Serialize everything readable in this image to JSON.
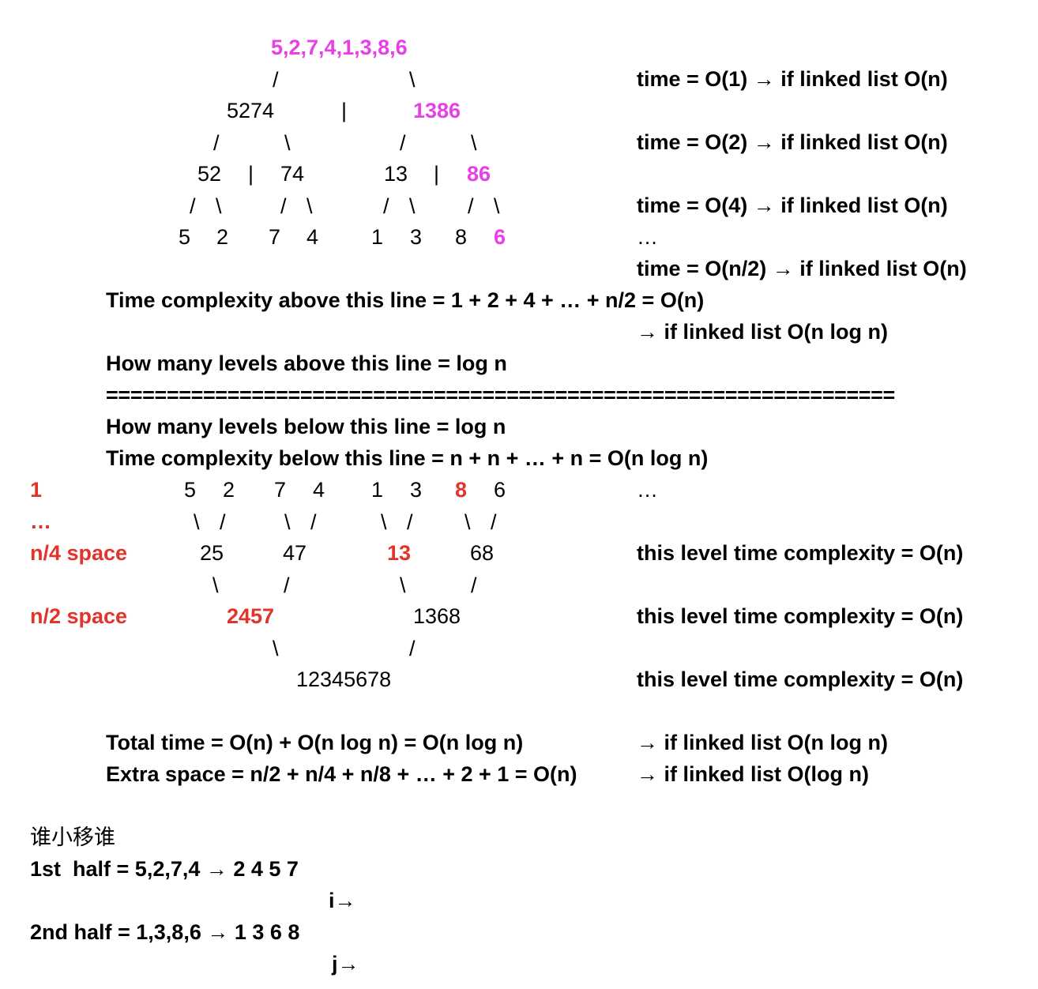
{
  "colors": {
    "text": "#000000",
    "highlight_magenta": "#e83fe8",
    "highlight_red": "#e3332b"
  },
  "split_tree": {
    "root": "5,2,7,4,1,3,8,6",
    "level1": {
      "left": "5274",
      "divider": "|",
      "right": "1386"
    },
    "level2": {
      "a": "52",
      "div1": "|",
      "b": "74",
      "c": "13",
      "div2": "|",
      "d": "86"
    },
    "level3": [
      "5",
      "2",
      "7",
      "4",
      "1",
      "3",
      "8",
      "6"
    ],
    "slash": "/",
    "backslash": "\\"
  },
  "right_notes_top": [
    "time = O(1) → if linked list O(n)",
    "time = O(2) → if linked list O(n)",
    "time = O(4) → if linked list O(n)",
    "…",
    "time = O(n/2) → if linked list O(n)"
  ],
  "above_summary": {
    "time_line": "Time complexity above this line = 1 + 2 + 4 + … + n/2 = O(n)",
    "linked_note": "→ if linked list O(n log n)",
    "levels_line": "How many levels above this line = log n"
  },
  "separator": "=================================================================",
  "below_summary": {
    "levels_line": "How many levels below this line = log n",
    "time_line": "Time complexity below this line = n + n + … + n = O(n log n)"
  },
  "merge_tree": {
    "left_labels": [
      "1",
      "…",
      "n/4 space",
      "n/2 space"
    ],
    "level0": [
      "5",
      "2",
      "7",
      "4",
      "1",
      "3",
      "8",
      "6"
    ],
    "level0_ellipsis": "…",
    "level1": [
      "25",
      "47",
      "13",
      "68"
    ],
    "level2": [
      "2457",
      "1368"
    ],
    "level3": "12345678",
    "level_note": "this level time complexity = O(n)"
  },
  "totals": {
    "total_time": "Total time = O(n) + O(n log n) = O(n log n)",
    "total_time_linked": "→ if linked list O(n log n)",
    "extra_space": "Extra space = n/2 + n/4 + n/8 + … + 2 + 1 = O(n)",
    "extra_space_linked": "→ if linked list O(log n)"
  },
  "merge_example": {
    "heading": "谁小移谁",
    "first_half": "1st  half = 5,2,7,4 → 2 4 5 7",
    "i_pointer": "i→",
    "second_half": "2nd half = 1,3,8,6 → 1 3 6 8",
    "j_pointer": "j→"
  }
}
